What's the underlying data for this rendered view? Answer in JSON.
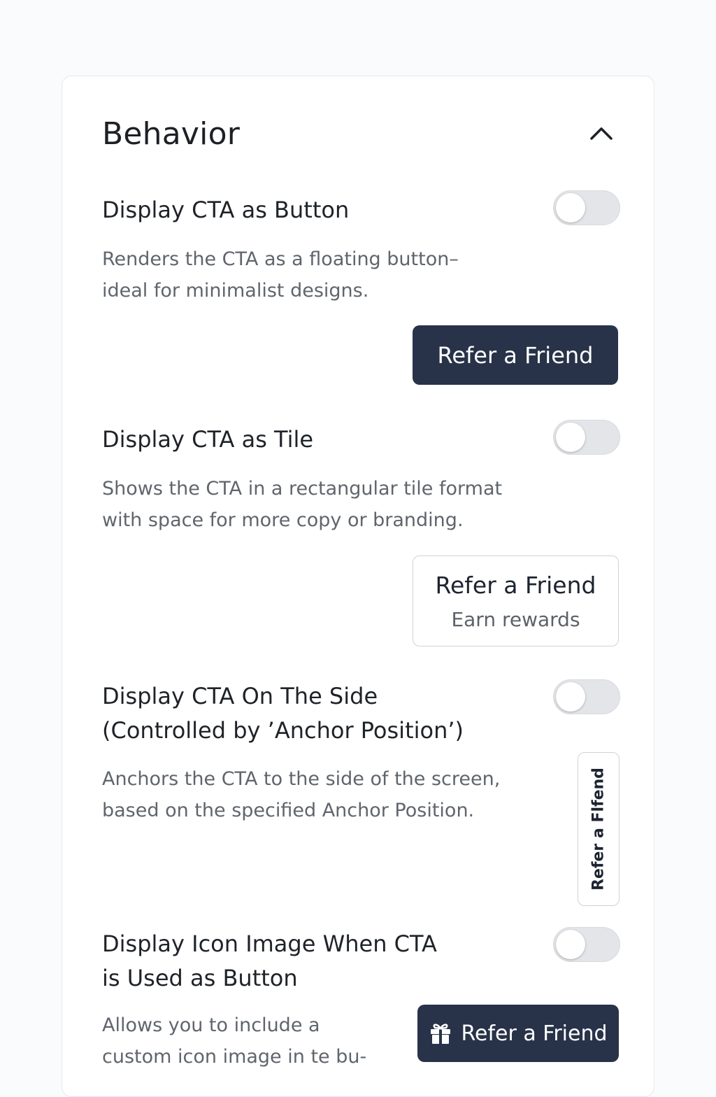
{
  "section": {
    "title": "Behavior",
    "collapse_icon": "chevron-up-icon"
  },
  "options": [
    {
      "title_lines": [
        "Display CTA as Button"
      ],
      "description_lines": [
        "Renders the CTA as a floating button–",
        "ideal for minimalist designs."
      ],
      "enabled": false,
      "preview_label": "Refer a Friend"
    },
    {
      "title_lines": [
        "Display CTA as Tile"
      ],
      "description_lines": [
        "Shows the CTA in a rectangular tile format",
        "with space for more copy or branding."
      ],
      "enabled": false,
      "preview_label": "Refer a Friend",
      "preview_sublabel": "Earn rewards"
    },
    {
      "title_lines": [
        "Display CTA On The Side",
        "(Controlled by ’Anchor Position’)"
      ],
      "description_lines": [
        "Anchors the CTA to the side of the screen,",
        "based on the specified Anchor Position."
      ],
      "enabled": false,
      "preview_label": "Refer a Flfend"
    },
    {
      "title_lines": [
        "Display Icon Image When CTA",
        "is Used as Button"
      ],
      "description_lines": [
        "Allows you to include a",
        "custom icon image in te bu-"
      ],
      "enabled": false,
      "preview_label": "Refer a Friend",
      "preview_icon": "gift-icon"
    }
  ],
  "colors": {
    "button_bg": "#283349",
    "toggle_off": "#e3e5e8",
    "panel_border": "#e5e7eb"
  }
}
